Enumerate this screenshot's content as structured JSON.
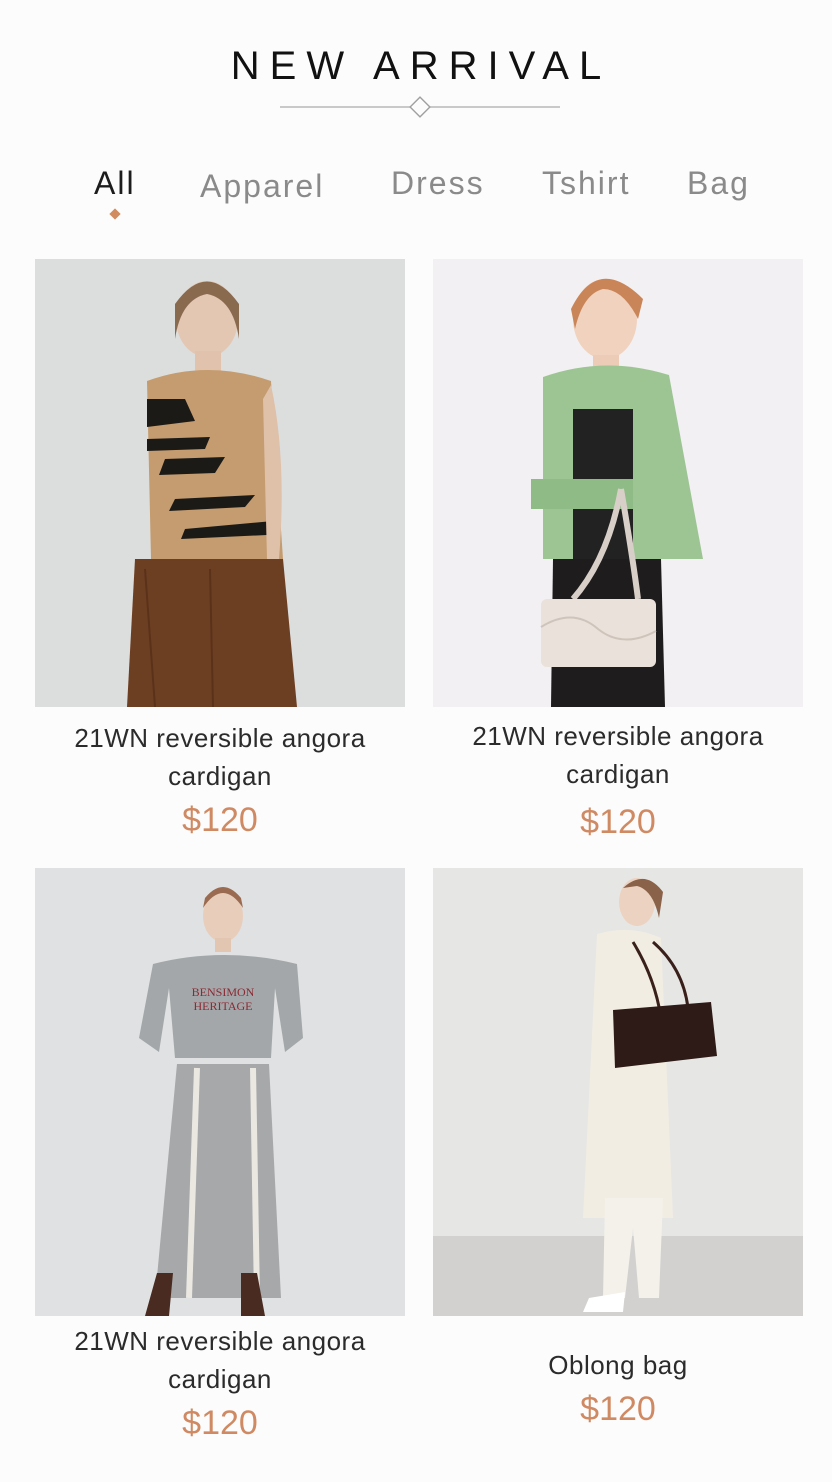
{
  "header": {
    "title": "NEW ARRIVAL"
  },
  "tabs": [
    {
      "label": "All",
      "active": true
    },
    {
      "label": "Apparel",
      "active": false
    },
    {
      "label": "Dress",
      "active": false
    },
    {
      "label": "Tshirt",
      "active": false
    },
    {
      "label": "Bag",
      "active": false
    }
  ],
  "colors": {
    "accent": "#cf8a63",
    "title": "#111111",
    "tab_inactive": "#8a8a8a"
  },
  "products": [
    {
      "name": "21WN reversible angora cardigan",
      "price": "$120",
      "image": "knit-vest-corduroy-pants-photo"
    },
    {
      "name": "21WN reversible angora cardigan",
      "price": "$120",
      "image": "green-cardigan-white-bag-photo"
    },
    {
      "name": "21WN reversible angora cardigan",
      "price": "$120",
      "image": "grey-sweatshirt-skirt-photo",
      "print": "BENSIMON HERITAGE"
    },
    {
      "name": "Oblong bag",
      "price": "$120",
      "image": "white-coat-brown-bag-photo"
    }
  ]
}
